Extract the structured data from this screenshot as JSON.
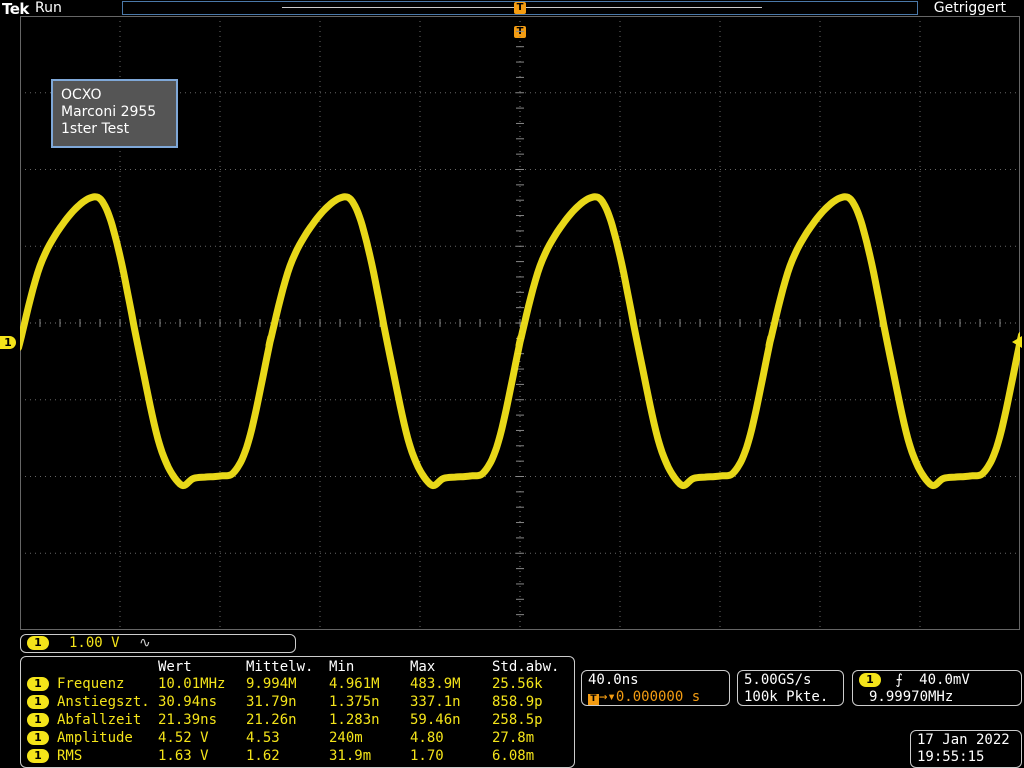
{
  "header": {
    "logo": "Tek",
    "acq_state": "Run",
    "trigger_status": "Getriggert",
    "trigger_marker": "T"
  },
  "annotation": {
    "line1": "OCXO",
    "line2": "Marconi 2955",
    "line3": "1ster Test"
  },
  "channel": {
    "number": "1",
    "scale": "1.00 V",
    "bandwidth_symbol": "∿",
    "color": "#f4e41a"
  },
  "measurements": {
    "headers": [
      "Wert",
      "Mittelw.",
      "Min",
      "Max",
      "Std.abw."
    ],
    "rows": [
      {
        "ch": "1",
        "name": "Frequenz",
        "wert": "10.01MHz",
        "mittel": "9.994M",
        "min": "4.961M",
        "max": "483.9M",
        "std": "25.56k"
      },
      {
        "ch": "1",
        "name": "Anstiegszt.",
        "wert": "30.94ns",
        "mittel": "31.79n",
        "min": "1.375n",
        "max": "337.1n",
        "std": "858.9p"
      },
      {
        "ch": "1",
        "name": "Abfallzeit",
        "wert": "21.39ns",
        "mittel": "21.26n",
        "min": "1.283n",
        "max": "59.46n",
        "std": "258.5p"
      },
      {
        "ch": "1",
        "name": "Amplitude",
        "wert": "4.52 V",
        "mittel": "4.53",
        "min": "240m",
        "max": "4.80",
        "std": "27.8m"
      },
      {
        "ch": "1",
        "name": "RMS",
        "wert": "1.63 V",
        "mittel": "1.62",
        "min": "31.9m",
        "max": "1.70",
        "std": "6.08m"
      }
    ]
  },
  "horizontal": {
    "time_per_div": "40.0ns",
    "trigger_position": "0.000000 s"
  },
  "acquisition": {
    "sample_rate": "5.00GS/s",
    "record_length": "100k Pkte."
  },
  "trigger": {
    "channel": "1",
    "slope_symbol": "⨍",
    "level": "40.0mV",
    "frequency": "9.99970MHz"
  },
  "datetime": {
    "date": "17 Jan  2022",
    "time": "19:55:15"
  },
  "colors": {
    "trace": "#f4e41a",
    "trigger": "#f39c12",
    "frame": "#4a78a8"
  }
}
